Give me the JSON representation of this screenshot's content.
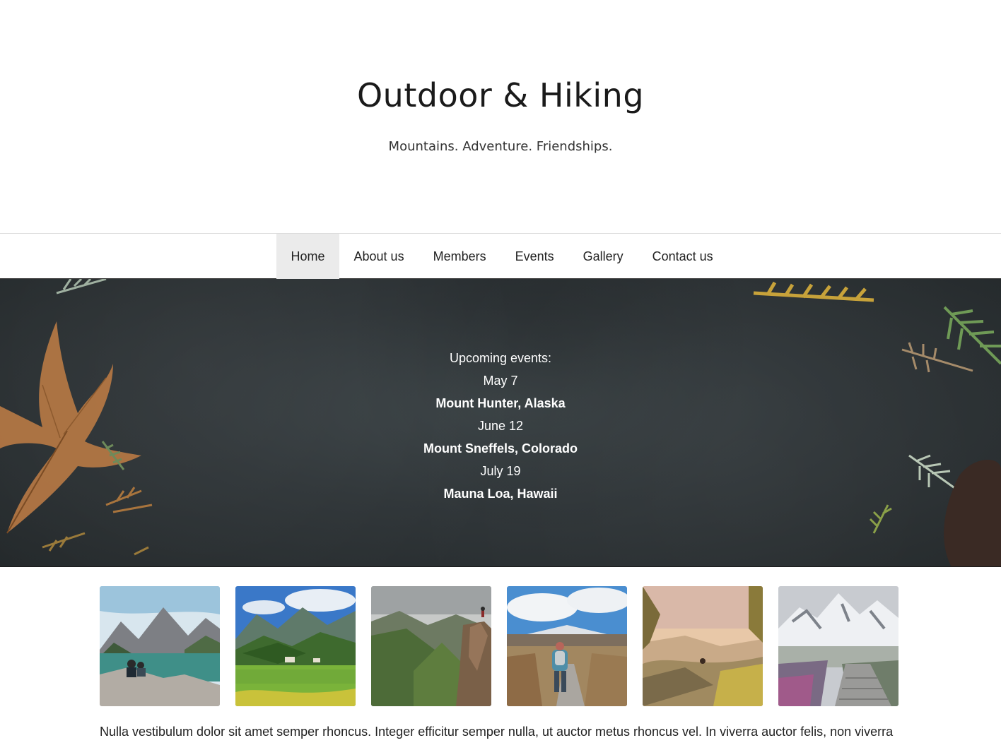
{
  "header": {
    "title": "Outdoor & Hiking",
    "tagline": "Mountains. Adventure. Friendships."
  },
  "nav": {
    "items": [
      {
        "label": "Home",
        "active": true
      },
      {
        "label": "About us",
        "active": false
      },
      {
        "label": "Members",
        "active": false
      },
      {
        "label": "Events",
        "active": false
      },
      {
        "label": "Gallery",
        "active": false
      },
      {
        "label": "Contact us",
        "active": false
      }
    ]
  },
  "hero": {
    "heading": "Upcoming events:",
    "events": [
      {
        "date": "May 7",
        "place": "Mount Hunter, Alaska"
      },
      {
        "date": "June 12",
        "place": "Mount Sneffels, Colorado"
      },
      {
        "date": "July 19",
        "place": "Mauna Loa, Hawaii"
      }
    ]
  },
  "gallery": {
    "photos": [
      {
        "icon": "lake-hikers-photo"
      },
      {
        "icon": "alpine-meadow-photo"
      },
      {
        "icon": "cliff-hiker-photo"
      },
      {
        "icon": "trail-hiker-photo"
      },
      {
        "icon": "sunset-valley-photo"
      },
      {
        "icon": "snowy-peak-path-photo"
      }
    ]
  },
  "content": {
    "paragraph": "Nulla vestibulum dolor sit amet semper rhoncus. Integer efficitur semper nulla, ut auctor metus rhoncus vel. In viverra auctor felis, non viverra"
  },
  "colors": {
    "nav_active_bg": "#ebebeb",
    "hero_bg": "#2f3538",
    "text": "#222222"
  }
}
